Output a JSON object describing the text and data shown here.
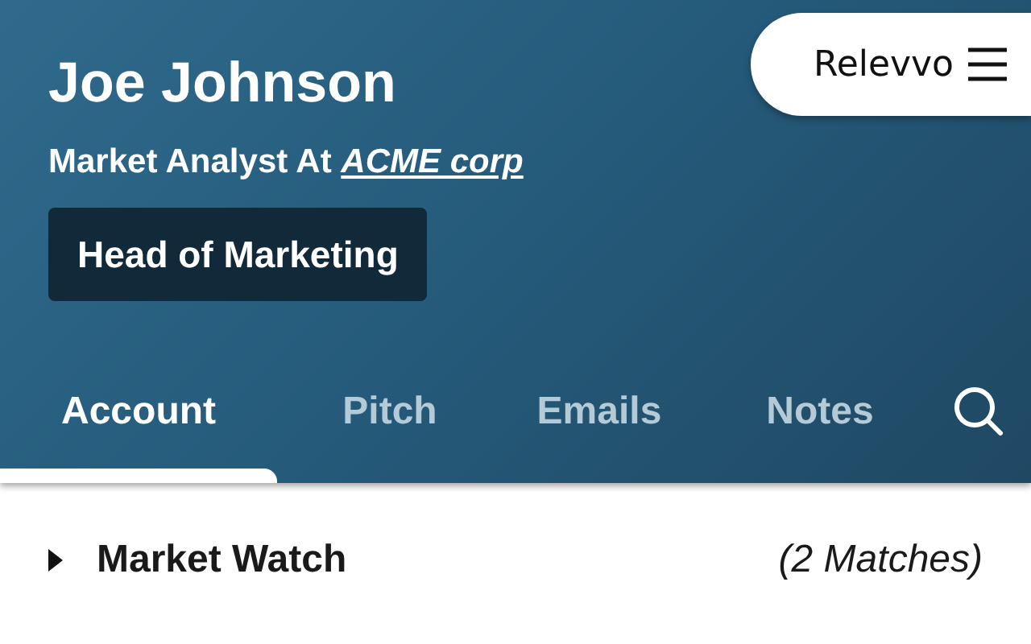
{
  "profile": {
    "name": "Joe Johnson",
    "role": "Market Analyst At",
    "company": "ACME corp",
    "tag": "Head of Marketing"
  },
  "logo": {
    "text": "Relevvo"
  },
  "tabs": [
    {
      "label": "Account",
      "selected": true
    },
    {
      "label": "Pitch",
      "selected": false
    },
    {
      "label": "Emails",
      "selected": false
    },
    {
      "label": "Notes",
      "selected": false
    }
  ],
  "sections": [
    {
      "title": "Market Watch",
      "count": "(2 Matches)",
      "expanded": false
    }
  ]
}
